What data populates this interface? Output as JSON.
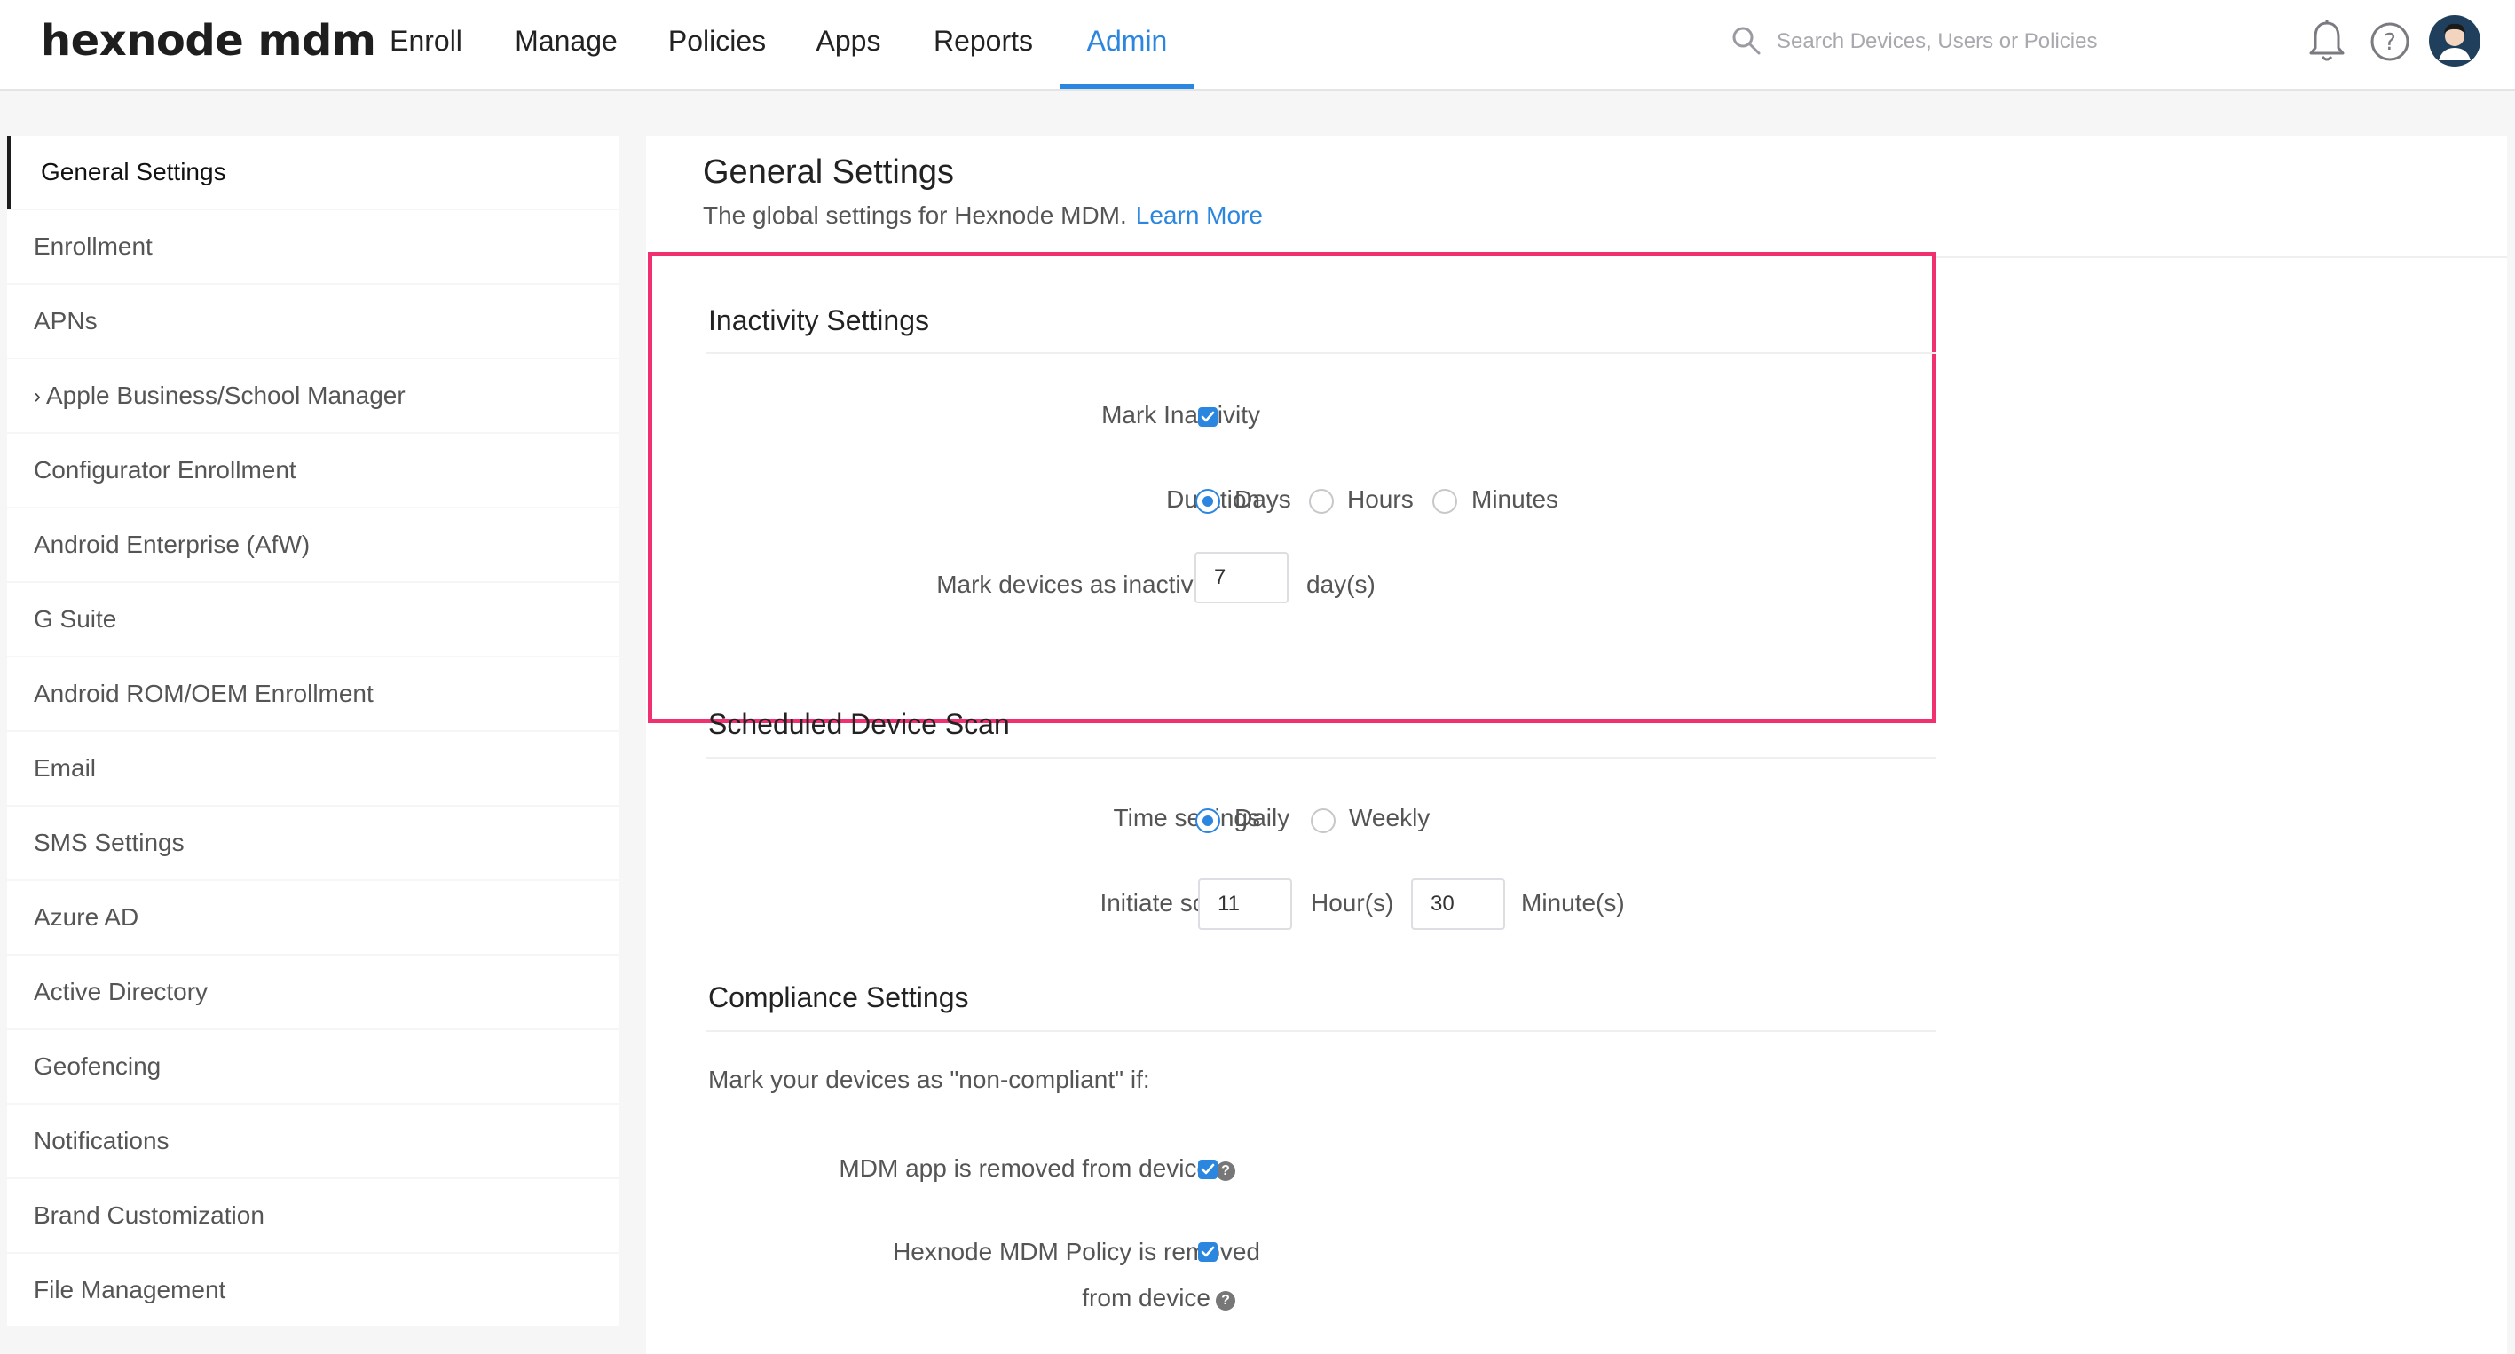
{
  "brand": {
    "logo_text": "hexnode mdm"
  },
  "nav": {
    "items": [
      {
        "label": "Enroll"
      },
      {
        "label": "Manage"
      },
      {
        "label": "Policies"
      },
      {
        "label": "Apps"
      },
      {
        "label": "Reports"
      },
      {
        "label": "Admin",
        "active": true
      }
    ]
  },
  "search": {
    "placeholder": "Search Devices, Users or Policies",
    "icon": "search-icon"
  },
  "header_icons": [
    "bell-icon",
    "help-icon",
    "user-avatar"
  ],
  "sidebar": {
    "items": [
      {
        "label": "General Settings",
        "active": true
      },
      {
        "label": "Enrollment"
      },
      {
        "label": "APNs"
      },
      {
        "label": "Apple Business/School Manager",
        "expandable": true
      },
      {
        "label": "Configurator Enrollment"
      },
      {
        "label": "Android Enterprise (AfW)"
      },
      {
        "label": "G Suite"
      },
      {
        "label": "Android ROM/OEM Enrollment"
      },
      {
        "label": "Email"
      },
      {
        "label": "SMS Settings"
      },
      {
        "label": "Azure AD"
      },
      {
        "label": "Active Directory"
      },
      {
        "label": "Geofencing"
      },
      {
        "label": "Notifications"
      },
      {
        "label": "Brand Customization"
      },
      {
        "label": "File Management"
      }
    ]
  },
  "page": {
    "title": "General Settings",
    "subtitle": "The global settings for Hexnode MDM.",
    "learn_more": "Learn More"
  },
  "inactivity": {
    "title": "Inactivity Settings",
    "mark_label": "Mark Inactivity",
    "mark_checked": true,
    "duration_label": "Duration",
    "duration_options": [
      "Days",
      "Hours",
      "Minutes"
    ],
    "duration_selected": "Days",
    "after_label": "Mark devices as inactive after",
    "after_value": "7",
    "after_unit": "day(s)"
  },
  "scan": {
    "title": "Scheduled Device Scan",
    "time_label": "Time settings",
    "time_options": [
      "Daily",
      "Weekly"
    ],
    "time_selected": "Daily",
    "initiate_label": "Initiate scan at",
    "hour_value": "11",
    "hour_unit": "Hour(s)",
    "minute_value": "30",
    "minute_unit": "Minute(s)"
  },
  "compliance": {
    "title": "Compliance Settings",
    "intro": "Mark your devices as \"non-compliant\" if:",
    "app_removed_label": "MDM app is removed from device",
    "app_removed_checked": true,
    "policy_removed_label_1": "Hexnode MDM Policy is removed",
    "policy_removed_label_2": "from device",
    "policy_removed_checked": true
  },
  "colors": {
    "accent": "#2b86e0",
    "highlight_border": "#f0306f"
  }
}
